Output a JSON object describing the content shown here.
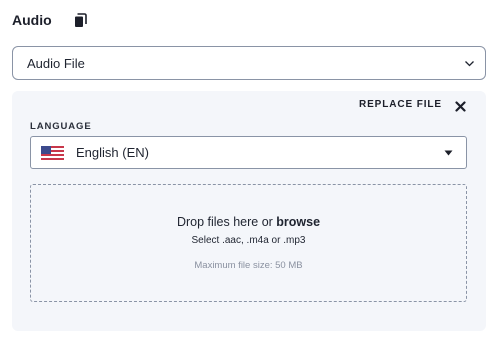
{
  "header": {
    "title": "Audio",
    "copy_icon": "copy-icon"
  },
  "type_select": {
    "value": "Audio File",
    "icon": "chevron-down-icon"
  },
  "panel": {
    "replace_label": "REPLACE FILE",
    "replace_icon": "close-icon",
    "language_label": "LANGUAGE",
    "language_select": {
      "value": "English (EN)",
      "flag_icon": "us-flag-icon",
      "caret_icon": "caret-down-icon"
    },
    "dropzone": {
      "prompt": "Drop files here or ",
      "browse_label": "browse",
      "formats": "Select .aac, .m4a or .mp3",
      "max_size": "Maximum file size: 50 MB"
    }
  },
  "colors": {
    "border": "#8a94a6",
    "panel_bg": "#f4f6fa",
    "text": "#1f2430",
    "muted": "#8a91a0"
  }
}
